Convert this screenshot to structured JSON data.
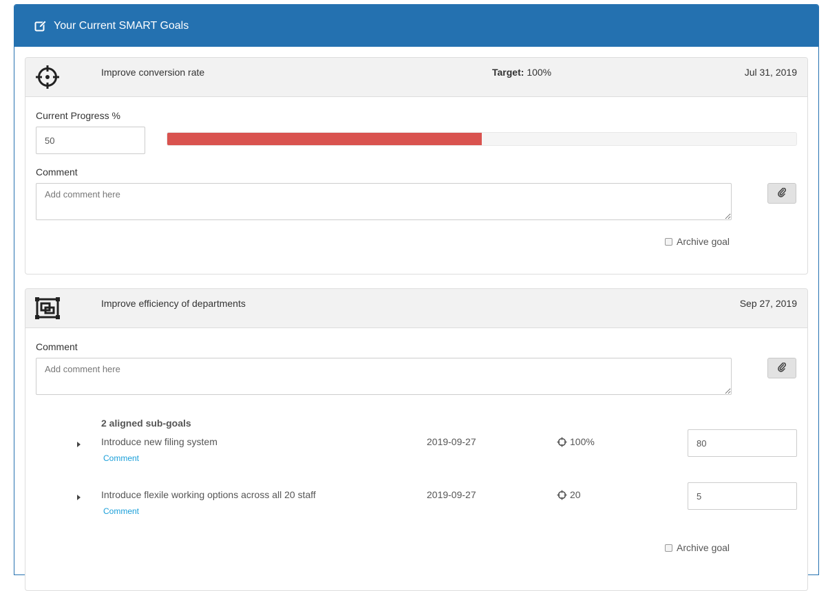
{
  "header": {
    "title": "Your Current SMART Goals",
    "icon": "edit-icon"
  },
  "colors": {
    "primary": "#2471b0",
    "progress": "#d9534f",
    "link": "#1a9fd9"
  },
  "goals": [
    {
      "icon": "crosshair-icon",
      "name": "Improve conversion rate",
      "target_label": "Target:",
      "target_value": "100%",
      "date": "Jul 31, 2019",
      "progress_label": "Current Progress %",
      "progress_value": "50",
      "progress_fraction": 0.5,
      "comment_label": "Comment",
      "comment_placeholder": "Add comment here",
      "archive_label": "Archive goal"
    },
    {
      "icon": "hierarchy-icon",
      "name": "Improve efficiency of departments",
      "date": "Sep 27, 2019",
      "comment_label": "Comment",
      "comment_placeholder": "Add comment here",
      "subgoals_title": "2 aligned sub-goals",
      "subgoals": [
        {
          "name": "Introduce new filing system",
          "comment_link": "Comment",
          "date": "2019-09-27",
          "target": "100%",
          "value": "80"
        },
        {
          "name": "Introduce flexile working options across all 20 staff",
          "comment_link": "Comment",
          "date": "2019-09-27",
          "target": "20",
          "value": "5"
        }
      ],
      "archive_label": "Archive goal"
    }
  ]
}
